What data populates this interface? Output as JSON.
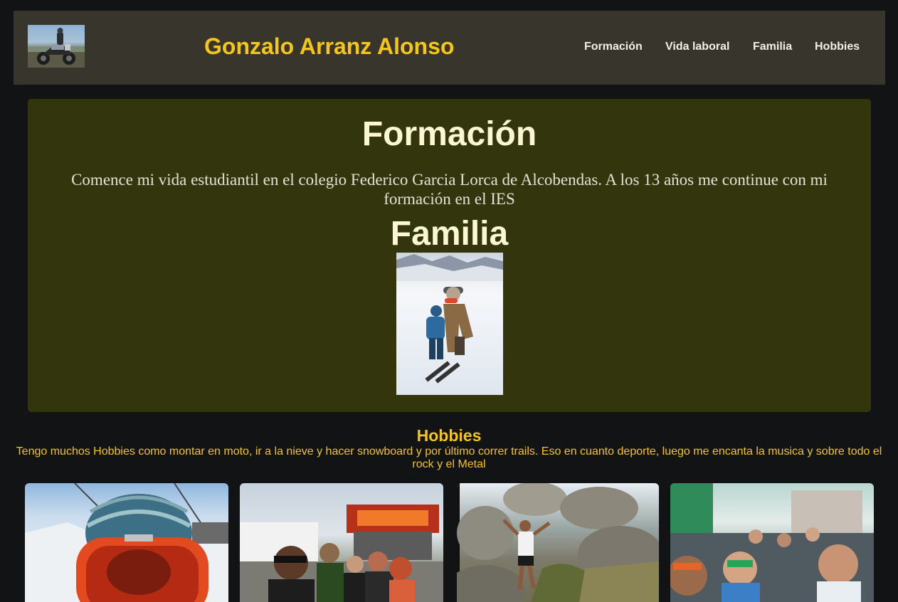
{
  "header": {
    "title": "Gonzalo Arranz Alonso",
    "logo_icon": "motorcycle-photo-icon",
    "nav": [
      {
        "label": "Formación"
      },
      {
        "label": "Vida laboral"
      },
      {
        "label": "Familia"
      },
      {
        "label": "Hobbies"
      }
    ]
  },
  "formacion": {
    "heading": "Formación",
    "text": "Comence mi vida estudiantil en el colegio Federico Garcia Lorca de Alcobendas. A los 13 años me continue con mi formación en el IES"
  },
  "familia": {
    "heading": "Familia",
    "photo_icon": "family-snow-photo-icon"
  },
  "hobbies": {
    "heading": "Hobbies",
    "text": "Tengo muchos Hobbies como montar en moto, ir a la nieve y hacer snowboard y por último correr trails. Eso en cuanto deporte, luego me encanta la musica y sobre todo el rock y el Metal",
    "gallery": [
      {
        "icon": "snowboard-goggles-photo-icon"
      },
      {
        "icon": "metal-festival-photo-icon"
      },
      {
        "icon": "trail-running-photo-icon"
      },
      {
        "icon": "football-fans-photo-icon"
      }
    ]
  },
  "colors": {
    "background": "#121314",
    "header": "#38362c",
    "panel": "#33360d",
    "accent": "#f5c518",
    "heading": "#fbf7d4"
  }
}
